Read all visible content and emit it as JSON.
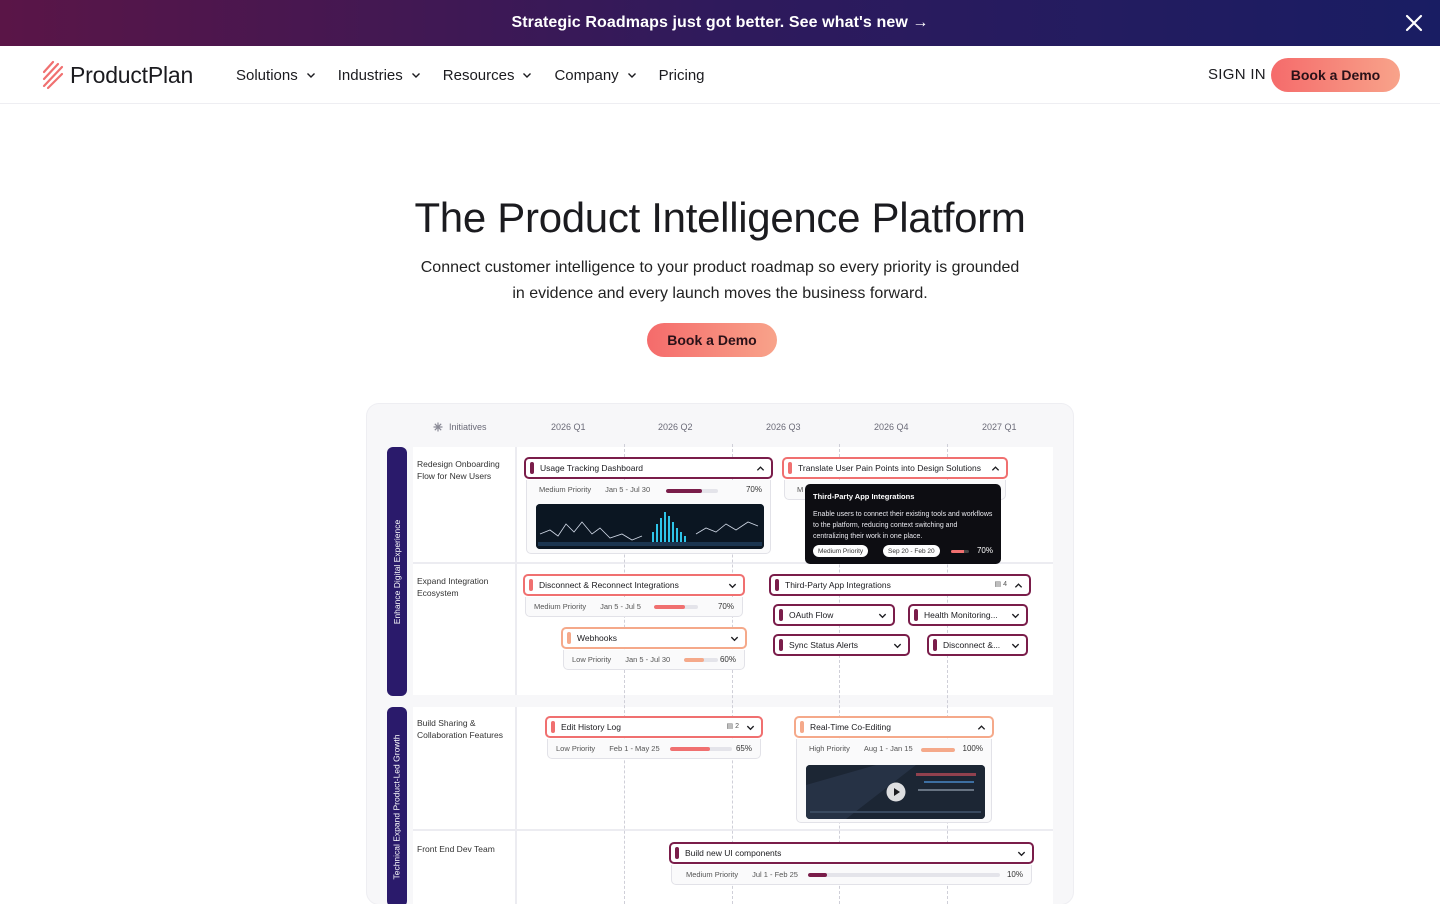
{
  "announcement": {
    "text": "Strategic Roadmaps just got better. See what's new →"
  },
  "nav": {
    "brand": "ProductPlan",
    "menu": [
      {
        "label": "Solutions",
        "has_dropdown": true
      },
      {
        "label": "Industries",
        "has_dropdown": true
      },
      {
        "label": "Resources",
        "has_dropdown": true
      },
      {
        "label": "Company",
        "has_dropdown": true
      },
      {
        "label": "Pricing",
        "has_dropdown": false
      }
    ],
    "sign_in": "SIGN IN",
    "cta": "Book a Demo"
  },
  "hero": {
    "title": "The Product Intelligence Platform",
    "subtitle": "Connect customer intelligence to your product roadmap so every priority is grounded in evidence and every launch moves the business forward.",
    "cta": "Book a Demo"
  },
  "roadmap": {
    "header": {
      "initiatives": "Initiatives",
      "quarters": [
        "2026 Q1",
        "2026 Q2",
        "2026 Q3",
        "2026 Q4",
        "2027 Q1"
      ]
    },
    "lanes": [
      "Enhance Digital Experience",
      "Technical Expand Product-Led Growth"
    ],
    "rows": [
      "Redesign Onboarding Flow for New Users",
      "Expand Integration Ecosystem",
      "Build Sharing & Collaboration Features",
      "Front End Dev Team"
    ],
    "bars": {
      "usage": {
        "title": "Usage Tracking Dashboard",
        "priority": "Medium Priority",
        "dates": "Jan 5 - Jul 30",
        "progress": 70,
        "pct": "70%"
      },
      "translate": {
        "title": "Translate User Pain Points into Design Solutions",
        "meta_partial": "M"
      },
      "disconnect": {
        "title": "Disconnect & Reconnect Integrations",
        "priority": "Medium Priority",
        "dates": "Jan 5 - Jul 5",
        "progress": 70,
        "pct": "70%"
      },
      "webhooks": {
        "title": "Webhooks",
        "priority": "Low Priority",
        "dates": "Jan 5 - Jul 30",
        "progress": 60,
        "pct": "60%"
      },
      "thirdparty": {
        "title": "Third-Party App Integrations",
        "badge": "4"
      },
      "oauth": {
        "title": "OAuth Flow"
      },
      "health": {
        "title": "Health Monitoring..."
      },
      "sync": {
        "title": "Sync Status Alerts"
      },
      "disconnect2": {
        "title": "Disconnect &..."
      },
      "history": {
        "title": "Edit History Log",
        "badge": "2",
        "priority": "Low Priority",
        "dates": "Feb 1 - May 25",
        "progress": 65,
        "pct": "65%"
      },
      "coedit": {
        "title": "Real-Time Co-Editing",
        "priority": "High Priority",
        "dates": "Aug 1 - Jan 15",
        "progress": 100,
        "pct": "100%"
      },
      "ui": {
        "title": "Build new UI components",
        "priority": "Medium Priority",
        "dates": "Jul 1 - Feb 25",
        "progress": 10,
        "pct": "10%"
      }
    },
    "tooltip": {
      "title": "Third-Party App Integrations",
      "body": "Enable users to connect their existing tools and workflows to the platform, reducing context switching and centralizing their work in one place.",
      "priority": "Medium Priority",
      "dates": "Sep 20 - Feb 20",
      "progress": 70,
      "pct": "70%"
    }
  },
  "colors": {
    "brand_dark": "#7a1d4a",
    "coral": "#f07070",
    "peach": "#f5a98a",
    "lane": "#2a1a6b",
    "banner_start": "#5a1547",
    "banner_end": "#191d63"
  }
}
